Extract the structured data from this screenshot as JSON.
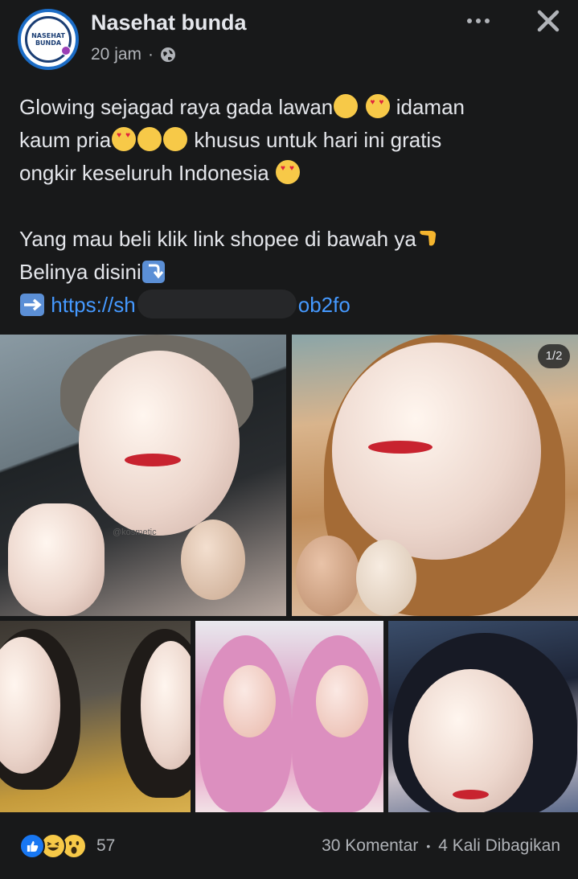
{
  "header": {
    "page_name": "Nasehat bunda",
    "time": "20 jam",
    "separator": "·",
    "avatar_text_line1": "NASEHAT",
    "avatar_text_line2": "BUNDA"
  },
  "post": {
    "line1_a": "Glowing sejagad raya gada lawan",
    "line1_b": " idaman",
    "line2_a": "kaum pria",
    "line2_b": " khusus untuk hari ini gratis",
    "line3": "ongkir keseluruh Indonesia ",
    "line4": "Yang mau beli klik link shopee di bawah ya",
    "line5": "Belinya disini",
    "link_start": "https://sh",
    "link_end": "ob2fo"
  },
  "gallery": {
    "counter": "1/2",
    "watermark": "@kosmetic"
  },
  "footer": {
    "reaction_count": "57",
    "comments": "30 Komentar",
    "dot": "•",
    "shares": "4 Kali Dibagikan"
  },
  "colors": {
    "background": "#18191a",
    "text_primary": "#e4e6eb",
    "text_secondary": "#b0b3b8",
    "link": "#4599ff",
    "like_blue": "#1877f2"
  }
}
